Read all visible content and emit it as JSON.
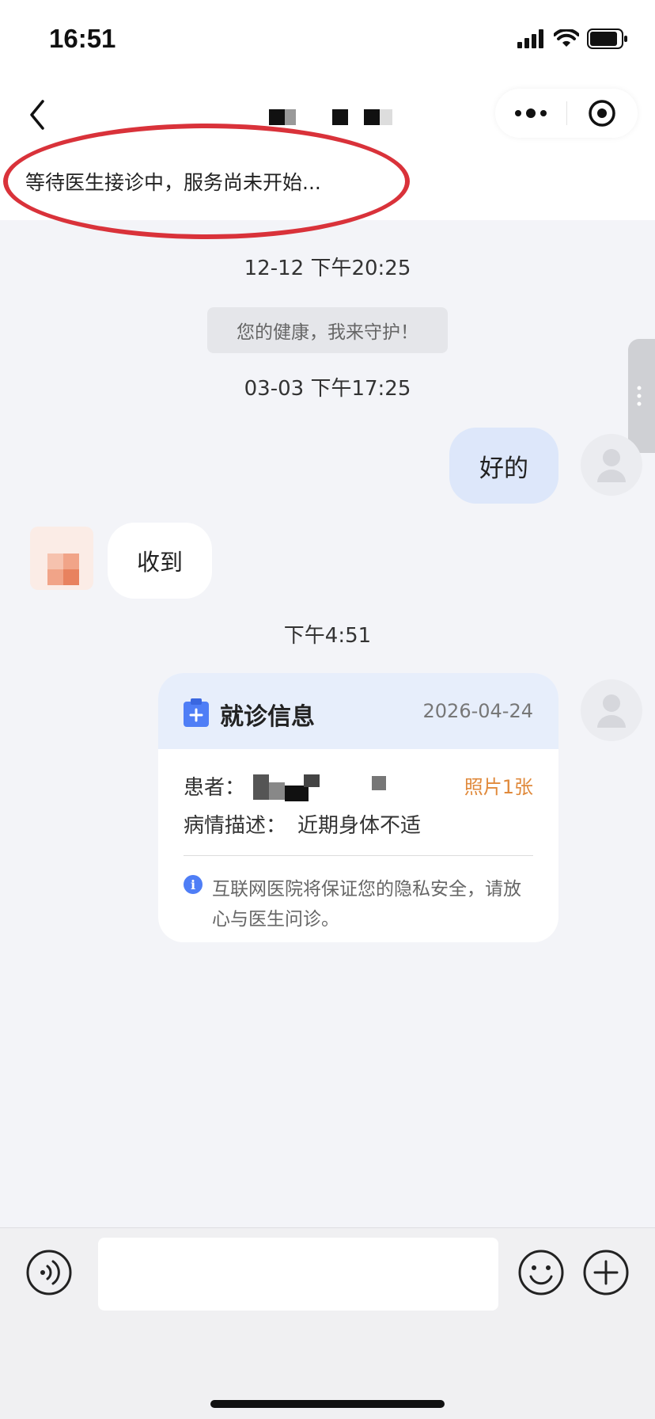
{
  "status_bar": {
    "time": "16:51"
  },
  "header": {
    "waiting_notice": "等待医生接诊中，服务尚未开始..."
  },
  "timeline": {
    "ts1": "12-12    下午20:25",
    "system_message": "您的健康，我来守护！",
    "ts2": "03-03    下午17:25",
    "ts3": "下午4:51"
  },
  "messages": {
    "outgoing_1": "好的",
    "incoming_1": "收到"
  },
  "visit_card": {
    "title": "就诊信息",
    "date": "2026-04-24",
    "patient_label": "患者：",
    "photo_link": "照片1张",
    "condition_label": "病情描述：",
    "condition_value": "近期身体不适",
    "privacy_notice": "互联网医院将保证您的隐私安全，请放心与医生问诊。"
  },
  "input_bar": {
    "placeholder": ""
  },
  "colors": {
    "accent_blue": "#4f7ef6",
    "annotation_red": "#d9323a",
    "photo_orange": "#e08a3c",
    "bubble_blue": "#dde7fa"
  },
  "icons": [
    "back-icon",
    "more-icon",
    "close-target-icon",
    "user-icon",
    "clipboard-icon",
    "info-icon",
    "voice-icon",
    "emoji-icon",
    "plus-icon",
    "signal-icon",
    "wifi-icon",
    "battery-icon"
  ]
}
